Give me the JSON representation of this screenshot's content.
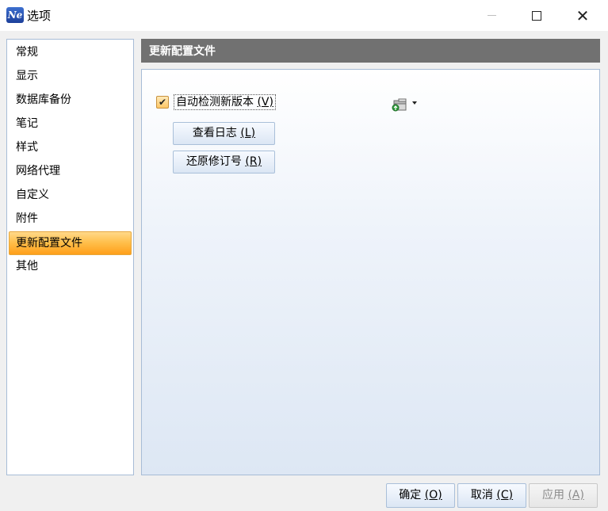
{
  "window": {
    "title": "选项",
    "app_icon_text": "Ne"
  },
  "sidebar": {
    "items": [
      {
        "label": "常规"
      },
      {
        "label": "显示"
      },
      {
        "label": "数据库备份"
      },
      {
        "label": "笔记"
      },
      {
        "label": "样式"
      },
      {
        "label": "网络代理"
      },
      {
        "label": "自定义"
      },
      {
        "label": "附件"
      },
      {
        "label": "更新配置文件",
        "selected": true
      },
      {
        "label": "其他"
      }
    ]
  },
  "panel": {
    "header": "更新配置文件",
    "auto_check": {
      "label": "自动检测新版本 ",
      "mnemonic": "(V)",
      "checked": true
    },
    "tool_icon": "package-update-icon",
    "view_log": {
      "label": "查看日志 ",
      "mnemonic": "(L)"
    },
    "restore_revision": {
      "label": "还原修订号 ",
      "mnemonic": "(R)"
    }
  },
  "footer": {
    "ok": {
      "label": "确定 ",
      "mnemonic": "(O)"
    },
    "cancel": {
      "label": "取消 ",
      "mnemonic": "(C)"
    },
    "apply": {
      "label": "应用 ",
      "mnemonic": "(A)",
      "disabled": true
    }
  },
  "colors": {
    "selected_item": "#ffc04d",
    "panel_header": "#717171",
    "border": "#a7bcd6"
  }
}
